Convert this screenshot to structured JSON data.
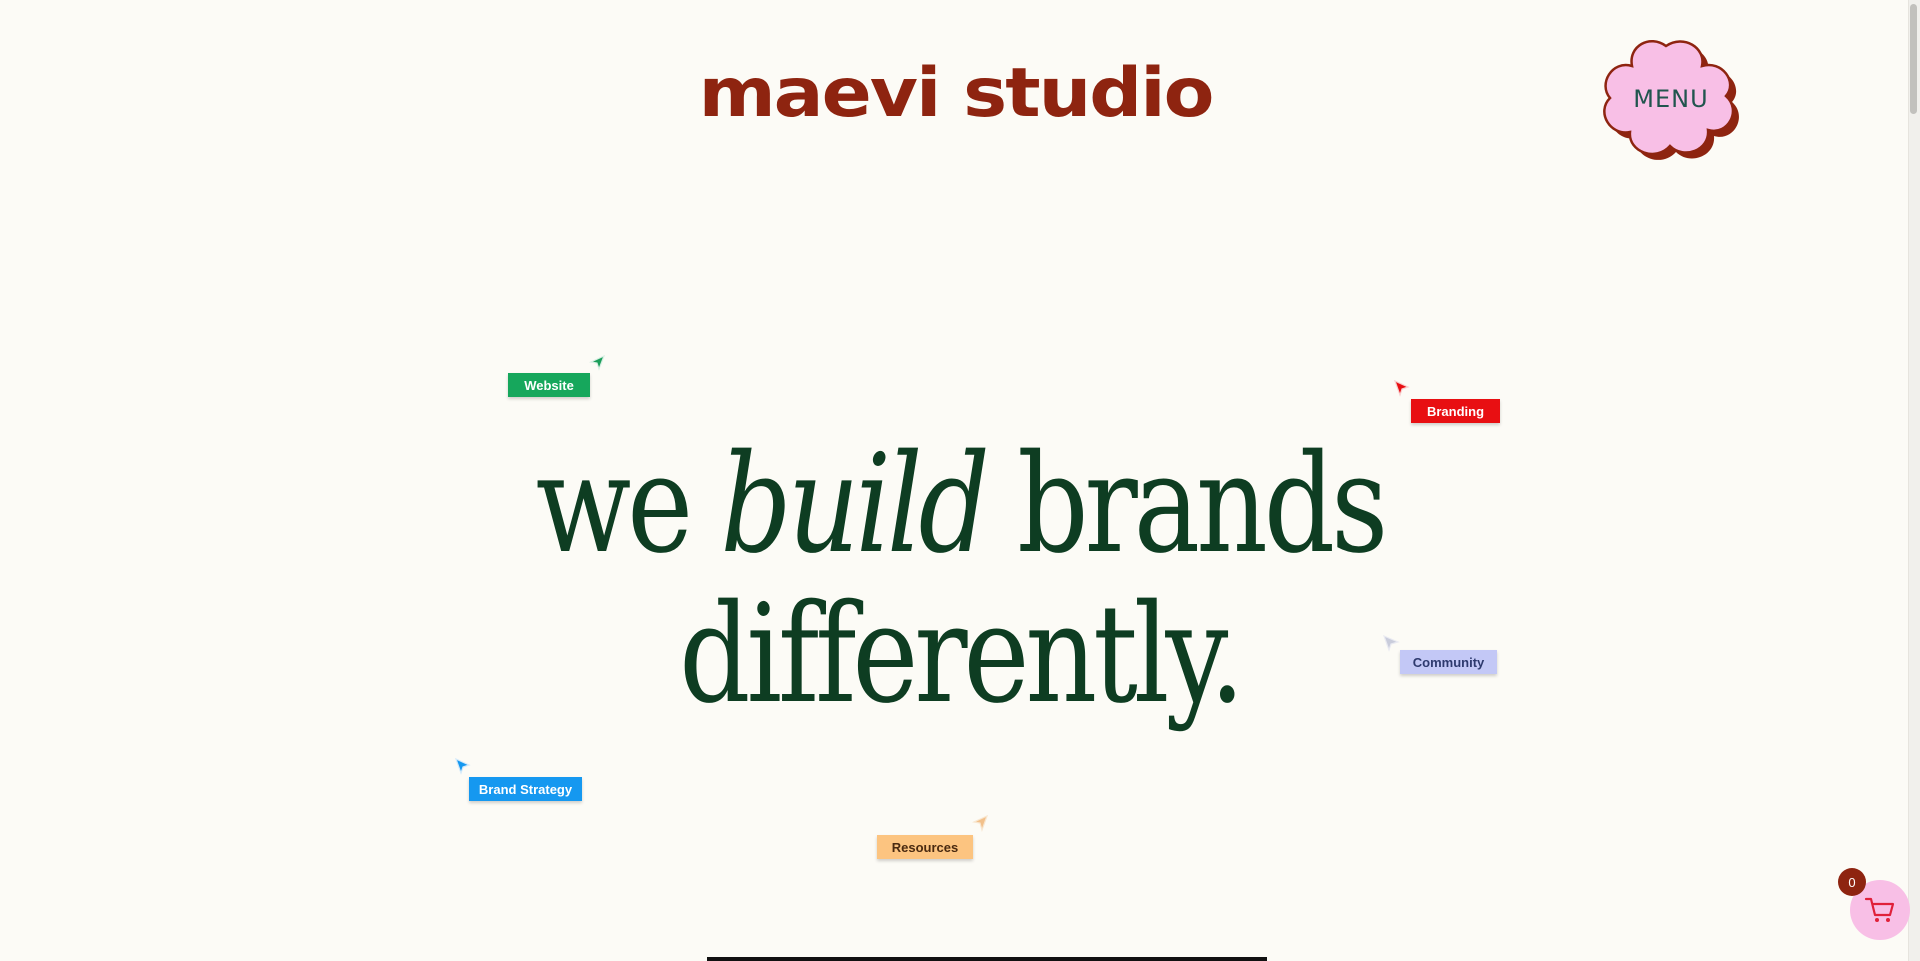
{
  "header": {
    "logo_text": "maevi studio",
    "menu_label": "MENU"
  },
  "hero": {
    "line1_word1": "we",
    "line1_word2": "build",
    "line1_word3": "brands",
    "line2": "differently."
  },
  "tags": [
    {
      "label": "Website",
      "color": "#16A75C",
      "text_color": "#FFFFFF",
      "cursor_color": "#1B9E5A"
    },
    {
      "label": "Branding",
      "color": "#E80F12",
      "text_color": "#FFFFFF",
      "cursor_color": "#E80F12"
    },
    {
      "label": "Community",
      "color": "#C3C8F6",
      "text_color": "#2E3A6E",
      "cursor_color": "#BCC0DA"
    },
    {
      "label": "Brand Strategy",
      "color": "#1598F0",
      "text_color": "#FFFFFF",
      "cursor_color": "#1598F0"
    },
    {
      "label": "Resources",
      "color": "#FCC480",
      "text_color": "#4A2A10",
      "cursor_color": "#F2C08A"
    }
  ],
  "cart": {
    "count": "0",
    "icon": "cart-icon"
  },
  "colors": {
    "background": "#FCFBF6",
    "logo": "#8E2410",
    "headline": "#0E3D22",
    "menu_fill": "#F8BFE6",
    "menu_shadow": "#8E2410",
    "menu_text": "#21554E"
  }
}
